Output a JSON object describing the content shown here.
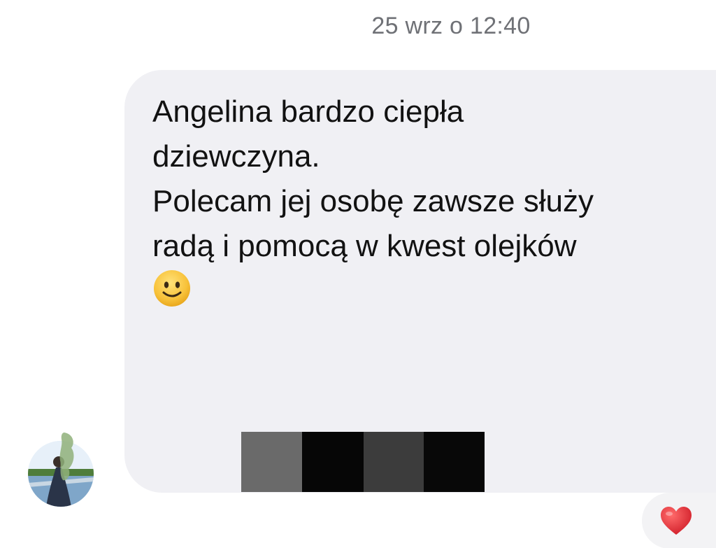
{
  "chat": {
    "timestamp": "25 wrz o 12:40",
    "message": {
      "lines": [
        "Angelina bardzo ciepła",
        "dziewczyna.",
        "Polecam jej osobę zawsze służy",
        "radą i pomocą w kwest olejków"
      ],
      "emoji": "slightly-smiling-face-icon"
    },
    "redaction_colors": [
      "#6a6a6a",
      "#060606",
      "#3c3c3c",
      "#080808"
    ],
    "reaction": {
      "icon": "heart-icon",
      "color": "#e0323a"
    }
  },
  "colors": {
    "bubble": "#f0f0f4",
    "timestamp_text": "#6f7176",
    "message_text": "#121212"
  }
}
